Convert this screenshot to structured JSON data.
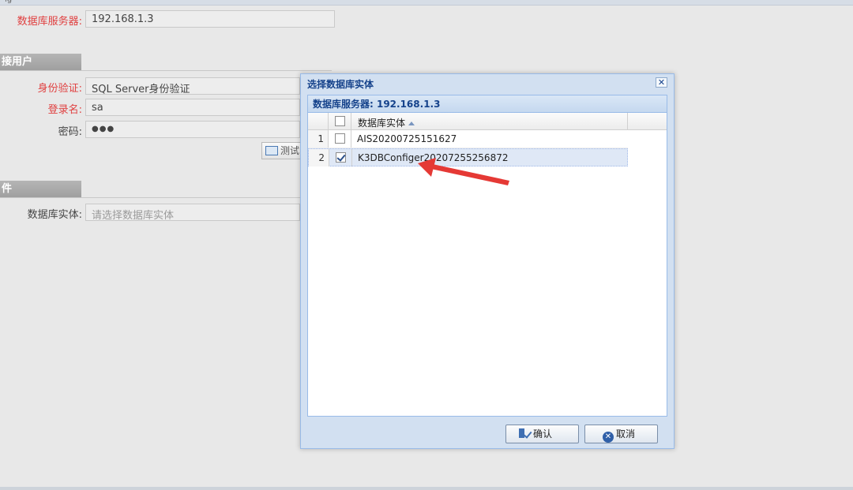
{
  "top_tick": "ig",
  "server": {
    "label": "数据库服务器:",
    "value": "192.168.1.3"
  },
  "section_user": {
    "title": "接用户"
  },
  "auth": {
    "label": "身份验证:",
    "value": "SQL Server身份验证"
  },
  "login": {
    "label": "登录名:",
    "value": "sa"
  },
  "password": {
    "label": "密码:",
    "value": "●●●"
  },
  "test_button": {
    "label": "测试"
  },
  "section_file": {
    "title": "件"
  },
  "db_entity": {
    "label": "数据库实体:",
    "placeholder": "请选择数据库实体"
  },
  "dialog": {
    "title": "选择数据库实体",
    "close_glyph": "✕",
    "panel_title": "数据库服务器: 192.168.1.3",
    "column_header": "数据库实体",
    "rows": [
      {
        "num": "1",
        "name": "AIS20200725151627",
        "checked": false
      },
      {
        "num": "2",
        "name": "K3DBConfiger20207255256872",
        "checked": true
      }
    ],
    "ok_label": "确认",
    "cancel_label": "取消"
  },
  "colors": {
    "required": "#e04040",
    "accent": "#15428b",
    "arrow": "#e53935"
  }
}
